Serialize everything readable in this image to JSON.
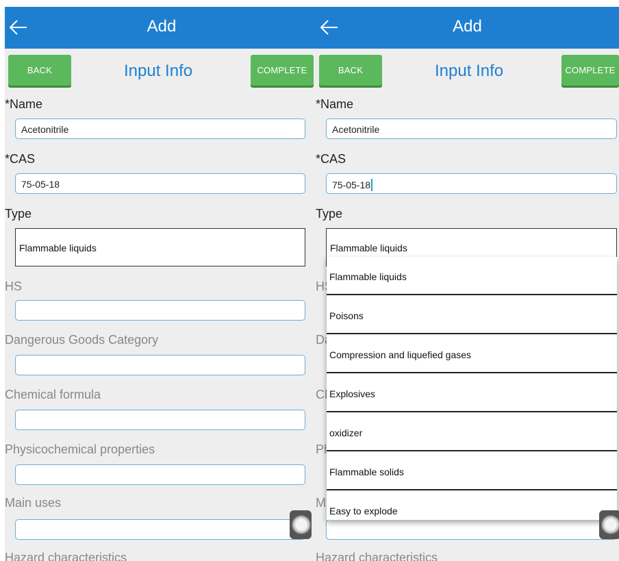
{
  "app_bar": {
    "title": "Add"
  },
  "toolbar": {
    "back_label": "BACK",
    "complete_label": "COMPLETE",
    "section_title": "Input Info"
  },
  "form": {
    "name_label": "*Name",
    "name_value": "Acetonitrile",
    "cas_label": "*CAS",
    "cas_value": "75-05-18",
    "type_label": "Type",
    "type_value": "Flammable liquids",
    "hs_label": "HS",
    "dangerous_goods_label": "Dangerous Goods Category",
    "chemical_formula_label": "Chemical formula",
    "physicochemical_label": "Physicochemical properties",
    "main_uses_label": "Main uses",
    "hazard_label": "Hazard characteristics"
  },
  "type_dropdown": {
    "options": [
      "Flammable liquids",
      "Poisons",
      "Compression and liquefied gases",
      "Explosives",
      "oxidizer",
      "Flammable solids",
      "Easy to explode"
    ]
  },
  "colors": {
    "app_bar": "#1e7fd1",
    "button": "#5cb85c",
    "field_border": "#6aaed6",
    "background": "#eeeeee"
  },
  "icons": {
    "back": "arrow-left-icon",
    "floating": "assistive-touch-icon"
  }
}
